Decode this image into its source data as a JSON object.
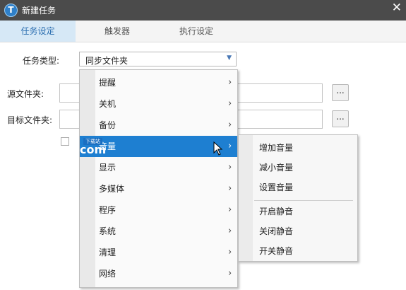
{
  "window": {
    "title": "新建任务",
    "close_symbol": "✕",
    "logo_glyph": "T"
  },
  "tabs": [
    {
      "label": "任务设定",
      "active": true
    },
    {
      "label": "触发器",
      "active": false
    },
    {
      "label": "执行设定",
      "active": false
    }
  ],
  "form": {
    "task_type_label": "任务类型:",
    "task_type_value": "同步文件夹",
    "source_label": "源文件夹:",
    "target_label": "目标文件夹:",
    "browse_label": "..."
  },
  "menu": {
    "items": [
      {
        "label": "提醒"
      },
      {
        "label": "关机"
      },
      {
        "label": "备份"
      },
      {
        "label": "音量",
        "highlighted": true
      },
      {
        "label": "显示"
      },
      {
        "label": "多媒体"
      },
      {
        "label": "程序"
      },
      {
        "label": "系统"
      },
      {
        "label": "清理"
      },
      {
        "label": "网络"
      }
    ],
    "chevron": "›"
  },
  "submenu": {
    "items": [
      {
        "label": "增加音量"
      },
      {
        "label": "减小音量"
      },
      {
        "label": "设置音量"
      },
      {
        "label": "开启静音"
      },
      {
        "label": "关闭静音"
      },
      {
        "label": "开关静音"
      }
    ]
  },
  "watermark": {
    "badge": "下载站",
    "text": "com"
  },
  "colors": {
    "titlebar": "#4b4b4b",
    "tab_active": "#d6e8f6",
    "highlight": "#1e7fd1"
  }
}
